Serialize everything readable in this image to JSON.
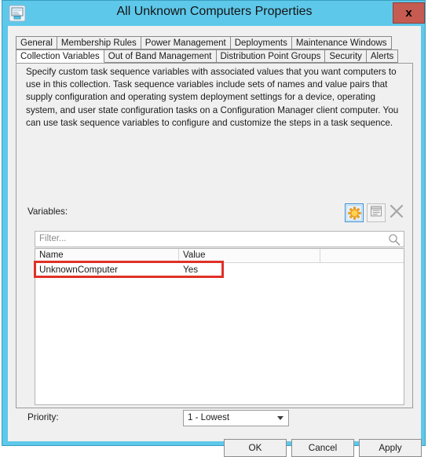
{
  "window": {
    "title": "All Unknown Computers Properties",
    "icon": "computer-icon",
    "close_label": "x",
    "titlebar_color": "#5ec8ea",
    "close_button_color": "#c65b52"
  },
  "tabs": {
    "row1": [
      {
        "label": "General",
        "selected": false
      },
      {
        "label": "Membership Rules",
        "selected": false
      },
      {
        "label": "Power Management",
        "selected": false
      },
      {
        "label": "Deployments",
        "selected": false
      },
      {
        "label": "Maintenance Windows",
        "selected": false
      }
    ],
    "row2": [
      {
        "label": "Collection Variables",
        "selected": true
      },
      {
        "label": "Out of Band Management",
        "selected": false
      },
      {
        "label": "Distribution Point Groups",
        "selected": false
      },
      {
        "label": "Security",
        "selected": false
      },
      {
        "label": "Alerts",
        "selected": false
      }
    ]
  },
  "page": {
    "description": "Specify custom task sequence variables with associated values that you want computers to use in this collection. Task sequence variables include sets of names and value pairs that supply configuration and operating system deployment settings for a device, operating system, and user state configuration tasks on a Configuration Manager client computer. You can use task sequence variables to configure and customize the steps in a task sequence.",
    "variables_label": "Variables:"
  },
  "toolbar": {
    "new_icon": "star-new-icon",
    "properties_icon": "properties-window-icon",
    "delete_icon": "delete-x-icon"
  },
  "filter": {
    "placeholder": "Filter...",
    "icon": "search-icon"
  },
  "list": {
    "columns": [
      "Name",
      "Value",
      ""
    ],
    "rows": [
      {
        "name": "UnknownComputer",
        "value": "Yes",
        "extra": ""
      }
    ]
  },
  "annotation": {
    "color": "#e03127",
    "target": "UnknownComputer row"
  },
  "priority": {
    "label": "Priority:",
    "value": "1 - Lowest",
    "options": [
      "1 - Lowest"
    ]
  },
  "buttons": {
    "ok": "OK",
    "cancel": "Cancel",
    "apply": "Apply"
  }
}
